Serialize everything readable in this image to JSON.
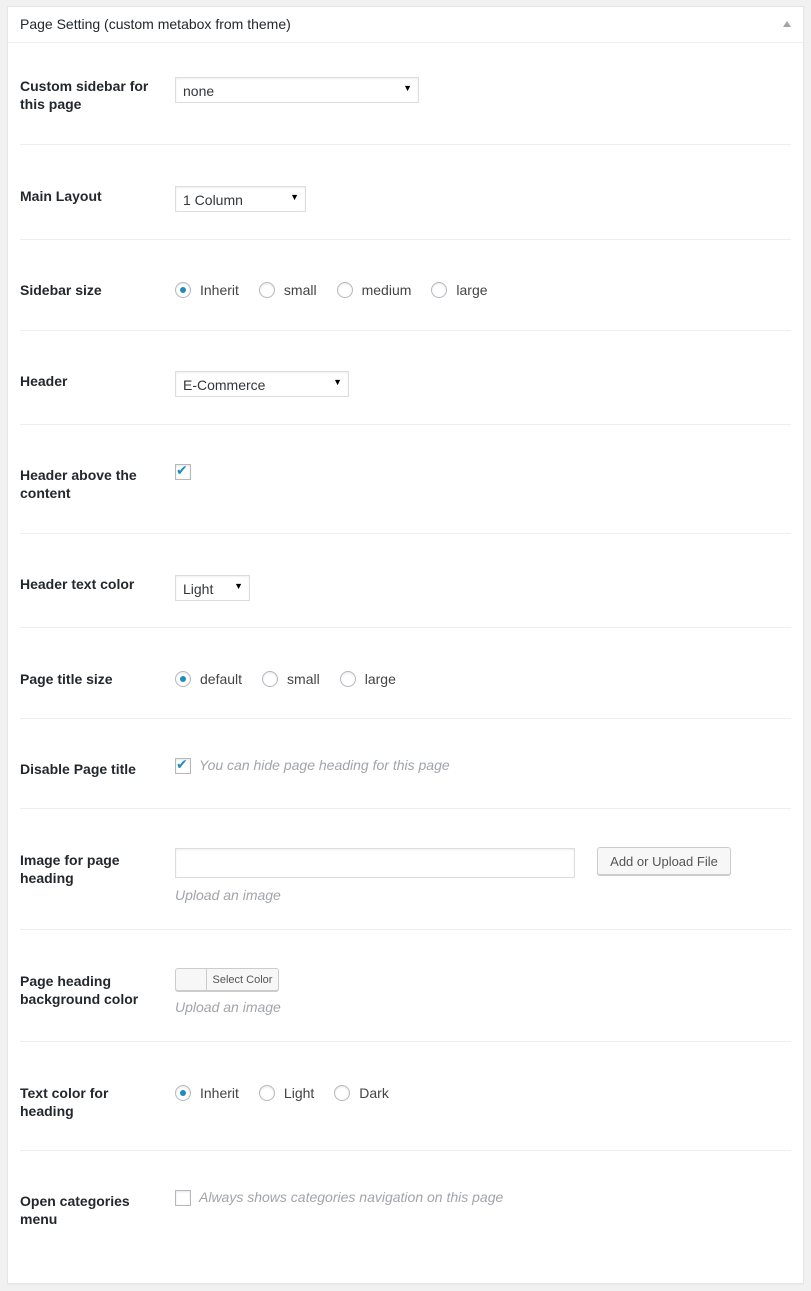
{
  "metabox": {
    "title": "Page Setting (custom metabox from theme)"
  },
  "fields": {
    "custom_sidebar": {
      "label": "Custom sidebar for this page",
      "value": "none"
    },
    "main_layout": {
      "label": "Main Layout",
      "value": "1 Column"
    },
    "sidebar_size": {
      "label": "Sidebar size",
      "options": [
        "Inherit",
        "small",
        "medium",
        "large"
      ],
      "selected": "Inherit"
    },
    "header": {
      "label": "Header",
      "value": "E-Commerce"
    },
    "header_above_content": {
      "label": "Header above the content",
      "checked": true
    },
    "header_text_color": {
      "label": "Header text color",
      "value": "Light"
    },
    "page_title_size": {
      "label": "Page title size",
      "options": [
        "default",
        "small",
        "large"
      ],
      "selected": "default"
    },
    "disable_page_title": {
      "label": "Disable Page title",
      "checked": true,
      "description": "You can hide page heading for this page"
    },
    "image_page_heading": {
      "label": "Image for page heading",
      "value": "",
      "button_label": "Add or Upload File",
      "description": "Upload an image"
    },
    "page_heading_bg_color": {
      "label": "Page heading background color",
      "button_label": "Select Color",
      "description": "Upload an image"
    },
    "text_color_heading": {
      "label": "Text color for heading",
      "options": [
        "Inherit",
        "Light",
        "Dark"
      ],
      "selected": "Inherit"
    },
    "open_categories_menu": {
      "label": "Open categories menu",
      "checked": false,
      "description": "Always shows categories navigation on this page"
    }
  },
  "colors": {
    "accent": "#1e8cbe",
    "background": "#f1f1f1",
    "panel": "#ffffff"
  },
  "icons": {
    "toggle": "triangle-up-icon",
    "dropdown": "caret-down-icon",
    "checkbox": "check-icon"
  }
}
